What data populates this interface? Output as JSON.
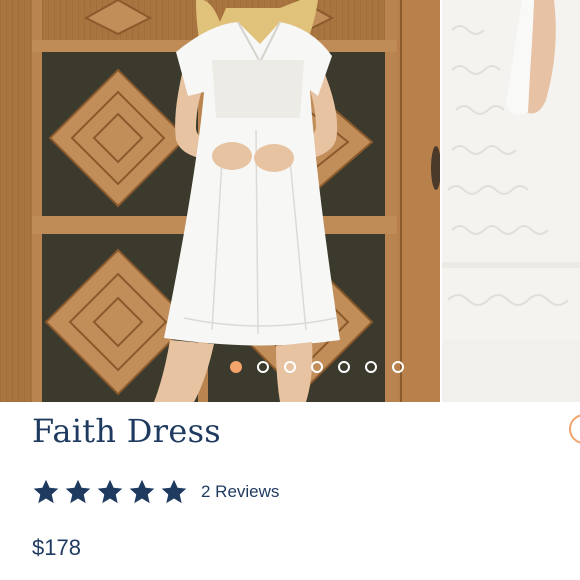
{
  "product": {
    "title": "Faith Dress",
    "rating": {
      "stars": 5,
      "max": 5,
      "reviews_label": "2 Reviews"
    },
    "price": "$178"
  },
  "gallery": {
    "slide_count": 7,
    "active_index": 0
  },
  "colors": {
    "brand_navy": "#1e3a5f",
    "accent_orange": "#f2a46a"
  },
  "icons": [
    "star-icon",
    "favorite-icon"
  ]
}
